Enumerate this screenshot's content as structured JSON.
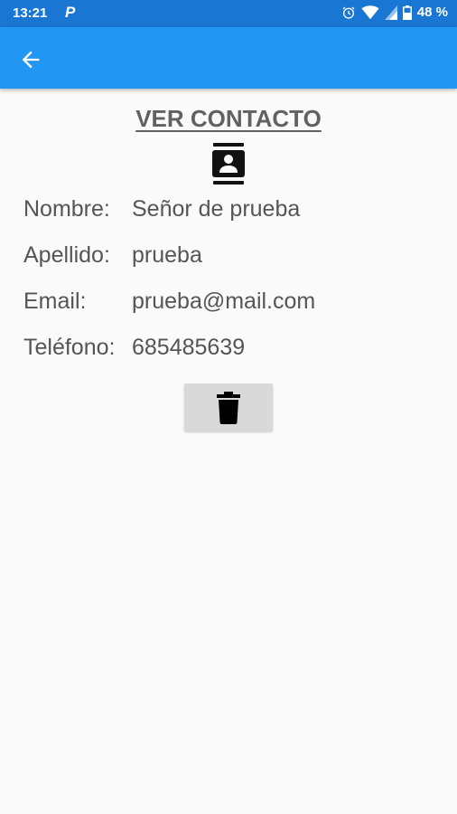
{
  "status_bar": {
    "time": "13:21",
    "app_icon_letter": "P",
    "battery_percent": "48 %",
    "icons": [
      "alarm-icon",
      "wifi-icon",
      "signal-icon",
      "battery-icon"
    ]
  },
  "app_bar": {
    "back_icon": "arrow-back-icon",
    "color": "#2196f3"
  },
  "page": {
    "title": "VER CONTACTO",
    "header_icon": "contact-card-icon"
  },
  "contact": {
    "nombre_label": "Nombre:",
    "nombre_value": "Señor de prueba",
    "apellido_label": "Apellido:",
    "apellido_value": "prueba",
    "email_label": "Email:",
    "email_value": "prueba@mail.com",
    "telefono_label": "Teléfono:",
    "telefono_value": "685485639"
  },
  "actions": {
    "delete_icon": "trash-icon"
  }
}
